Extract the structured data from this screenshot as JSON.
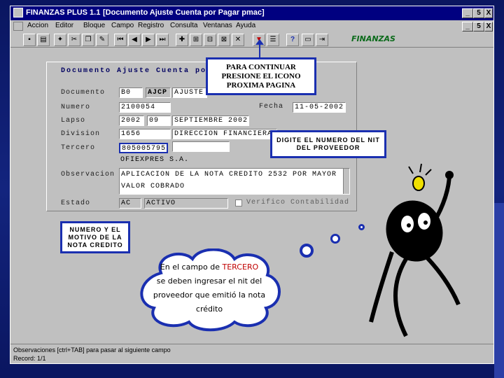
{
  "window": {
    "title": "FINANZAS PLUS 1.1",
    "subtitle": "[Documento Ajuste Cuenta por Pagar pmac]",
    "btn_min": "_",
    "btn_max": "5",
    "btn_close": "X"
  },
  "menu": [
    "Accion",
    "Editor",
    "Bloque",
    "Campo",
    "Registro",
    "Consulta",
    "Ventanas",
    "Ayuda"
  ],
  "toolbar": {
    "logo": "FINANZAS",
    "help": "?"
  },
  "form": {
    "title": "Documento Ajuste Cuenta por Pa",
    "labels": {
      "documento": "Documento",
      "numero": "Numero",
      "lapso": "Lapso",
      "division": "Division",
      "tercero": "Tercero",
      "observacion": "Observacion",
      "estado": "Estado",
      "fecha": "Fecha"
    },
    "documento_code": "B0",
    "documento_type": "AJCP",
    "documento_desc": "AJUSTE",
    "numero": "2100054",
    "lapso_year": "2002",
    "lapso_month": "09",
    "lapso_desc": "SEPTIEMBRE 2002",
    "fecha": "11-05-2002",
    "division_code": "1656",
    "division_desc": "DIRECCION FINANCIERA",
    "tercero": "805005795",
    "tercero_name": "OFIEXPRES S.A.",
    "obs_line1": "APLICACION DE LA NOTA CREDITO 2532 POR MAYOR",
    "obs_line2": "VALOR COBRADO",
    "estado_code": "AC",
    "estado_desc": "ACTIVO",
    "verificado": "Verifico Contabilidad"
  },
  "callouts": {
    "continuar": "PARA CONTINUAR PRESIONE EL ICONO PROXIMA PAGINA",
    "nit": "DIGITE EL NUMERO DEL NIT DEL PROVEEDOR",
    "motivo": "NUMERO Y EL MOTIVO DE LA NOTA CREDITO",
    "cloud_pre": "En el campo de ",
    "cloud_highlight": "TERCERO",
    "cloud_post": "se deben ingresar el nit del proveedor que emitió la nota crédito"
  },
  "status": {
    "line1": "Observaciones [ctrl+TAB] para pasar al siguiente campo",
    "line2": "Record: 1/1"
  },
  "colors": {
    "highlight": "#1a2fb0",
    "cloud_accent": "#c00000",
    "titlebar": "#000080"
  }
}
